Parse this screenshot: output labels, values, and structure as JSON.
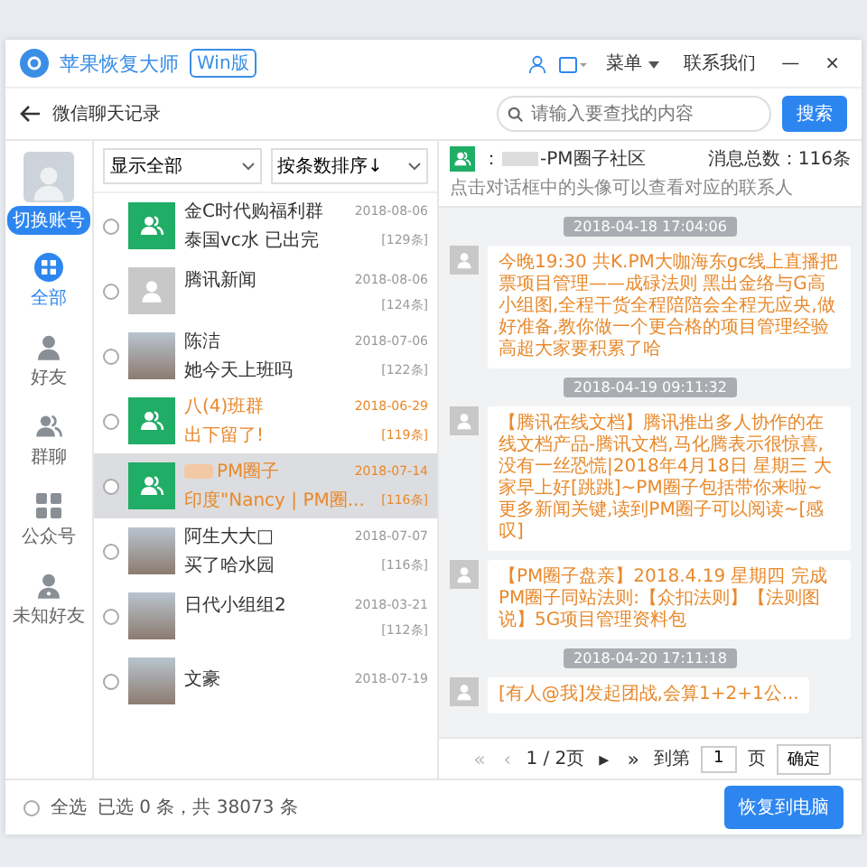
{
  "app": {
    "name": "苹果恢复大师",
    "edition": "Win版",
    "menu": "菜单",
    "contact": "联系我们",
    "minimize": "—",
    "close": "×"
  },
  "toolbar": {
    "title": "微信聊天记录",
    "search_placeholder": "请输入要查找的内容",
    "search_button": "搜索"
  },
  "sidebar": {
    "account_button": "切换账号",
    "nav": [
      {
        "label": "全部",
        "selected": true
      },
      {
        "label": "好友",
        "selected": false
      },
      {
        "label": "群聊",
        "selected": false
      },
      {
        "label": "公众号",
        "selected": false
      },
      {
        "label": "未知好友",
        "selected": false
      }
    ]
  },
  "list": {
    "filters": [
      "显示全部",
      "按条数排序↓"
    ],
    "items": [
      {
        "kind": "group",
        "title": "金C时代购福利群",
        "date": "2018-08-06",
        "preview": "泰国vc水 已出完",
        "count": "[129条]",
        "marked": false,
        "redacted": false,
        "selected": false,
        "checked": false
      },
      {
        "kind": "default",
        "title": "腾讯新闻",
        "date": "2018-08-06",
        "count": "[124条]",
        "marked": false,
        "redacted": false,
        "selected": false,
        "checked": false
      },
      {
        "kind": "photo",
        "title": "陈洁",
        "date": "2018-07-06",
        "preview": "她今天上班吗",
        "count": "[122条]",
        "marked": false,
        "redacted": false,
        "selected": false,
        "checked": false
      },
      {
        "kind": "group",
        "title": "八(4)班群",
        "date": "2018-06-29",
        "preview": "出下留了!",
        "count": "[119条]",
        "marked": true,
        "redacted": false,
        "selected": false,
        "checked": false
      },
      {
        "kind": "group",
        "title": "PM圈子",
        "date": "2018-07-14",
        "preview": "印度\"Nancy | PM圈...",
        "count": "[116条]",
        "marked": true,
        "redacted": true,
        "selected": true,
        "checked": false
      },
      {
        "kind": "photo",
        "title": "阿生大大□",
        "date": "2018-07-07",
        "preview": "买了哈水园",
        "count": "[116条]",
        "marked": false,
        "redacted": false,
        "selected": false,
        "checked": false
      },
      {
        "kind": "photo",
        "title": "日代小组组2",
        "date": "2018-03-21",
        "count": "[112条]",
        "marked": false,
        "redacted": false,
        "selected": false,
        "checked": false
      },
      {
        "kind": "photo",
        "title": "文豪",
        "date": "2018-07-19",
        "marked": false,
        "redacted": false,
        "selected": false,
        "checked": false
      }
    ]
  },
  "chat": {
    "prefix": "：",
    "name": "-PM圈子社区",
    "hint": "点击对话框中的头像可以查看对应的联系人",
    "total": "消息总数：116条",
    "messages": [
      {
        "kind": "time",
        "text": "2018-04-18 17:04:06"
      },
      {
        "kind": "message",
        "text": "今晚19:30 共K.PM大咖海东gc线上直播把票项目管理——成碌法则 黑出金络与G高小组图,全程干货全程陪陪会全程无应央,做好准备,教你做一个更合格的项目管理经验高超大家要积累了哈"
      },
      {
        "kind": "time",
        "text": "2018-04-19 09:11:32"
      },
      {
        "kind": "message",
        "text": "【腾讯在线文档】腾讯推出多人协作的在线文档产品-腾讯文档,马化腾表示很惊喜,没有一丝恐慌|2018年4月18日 星期三 大家早上好[跳跳]~PM圈子包括带你来啦~更多新闻关键,读到PM圈子可以阅读~[感叹]"
      },
      {
        "kind": "message",
        "text": "【PM圈子盘亲】2018.4.19 星期四 完成PM圈子同站法则:【众扣法则】【法则图说】5G项目管理资料包"
      },
      {
        "kind": "time",
        "text": "2018-04-20 17:11:18"
      },
      {
        "kind": "message",
        "text": "[有人@我]发起团战,会算1+2+1公..."
      }
    ]
  },
  "pager": {
    "buttons": [
      {
        "label": "«",
        "disabled": true
      },
      {
        "label": "‹",
        "disabled": true
      }
    ],
    "page": "1 / 2页",
    "next_buttons": [
      {
        "label": "▸",
        "disabled": false
      },
      {
        "label": "»",
        "disabled": false
      }
    ],
    "goto": "到第",
    "page_input": "1",
    "unit": "页",
    "confirm": "确定"
  },
  "footer": {
    "select_all": "全选",
    "select_all_checked": false,
    "summary": "已选 0 条，共 38073 条",
    "restore_button": "恢复到电脑"
  }
}
